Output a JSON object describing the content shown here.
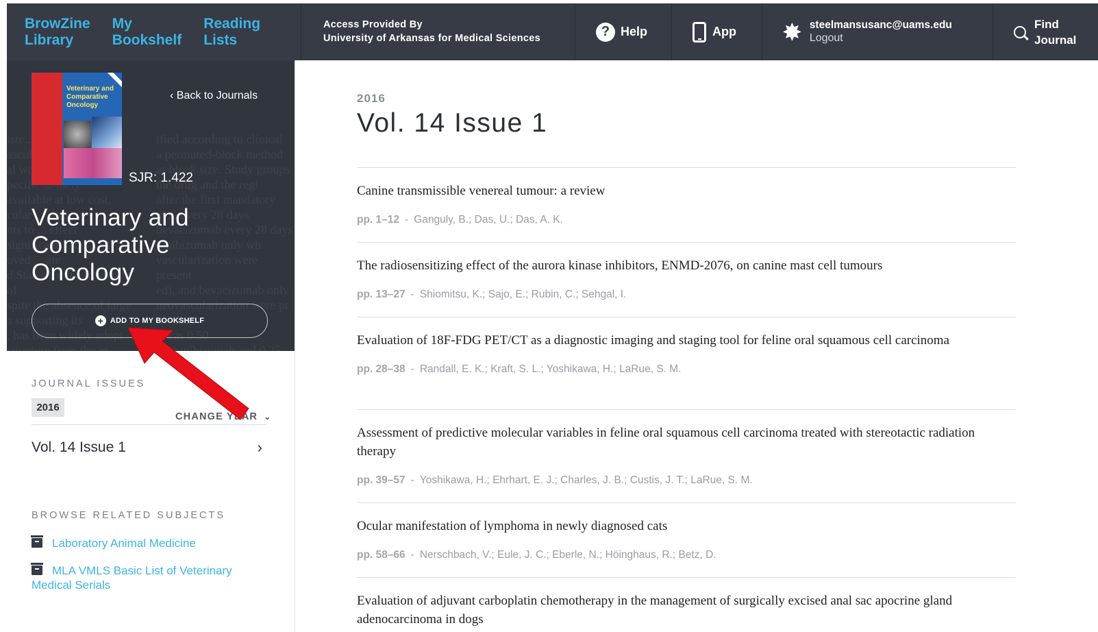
{
  "topbar": {
    "nav_links": [
      {
        "label": "BrowZine\nLibrary"
      },
      {
        "label": "My\nBookshelf"
      },
      {
        "label": "Reading\nLists"
      }
    ],
    "access_line1": "Access Provided By",
    "access_line2": "University of Arkansas for Medical Sciences",
    "help_label": "Help",
    "app_label": "App",
    "user_email": "steelmansusanc@uams.edu",
    "logout_label": "Logout",
    "find_journal_label": "Find\nJournal"
  },
  "sidebar": {
    "back_label": "Back to Journals",
    "sjr": "SJR: 1.422",
    "journal_title": "Veterinary and Comparative Oncology",
    "cover_title": "Veterinary and Comparative Oncology",
    "add_button_label": "ADD TO MY BOOKSHELF",
    "journal_issues_heading": "JOURNAL ISSUES",
    "selected_year": "2016",
    "change_year_label": "CHANGE YEAR",
    "issue_label": "Vol. 14 Issue 1",
    "related_heading": "BROWSE RELATED SUBJECTS",
    "subjects": [
      {
        "label": "Laboratory Animal Medicine"
      },
      {
        "label": "MLA VMLS Basic List of Veterinary Medical Serials"
      }
    ]
  },
  "main": {
    "year": "2016",
    "issue_title": "Vol. 14 Issue 1",
    "articles": [
      {
        "title": "Canine transmissible venereal tumour: a review",
        "pages": "pp. 1–12",
        "authors": "Ganguly, B.; Das, U.; Das, A. K."
      },
      {
        "title": "The radiosensitizing effect of the aurora kinase inhibitors, ENMD-2076, on canine mast cell tumours",
        "pages": "pp. 13–27",
        "authors": "Shiomitsu, K.; Sajo, E.; Rubin, C.; Sehgal, I."
      },
      {
        "title": "Evaluation of 18F-FDG PET/CT as a diagnostic imaging and staging tool for feline oral squamous cell carcinoma",
        "pages": "pp. 28–38",
        "authors": "Randall, E. K.; Kraft, S. L.; Yoshikawa, H.; LaRue, S. M."
      },
      {
        "title": "Assessment of predictive molecular variables in feline oral squamous cell carcinoma treated with stereotactic radiation therapy",
        "pages": "pp. 39–57",
        "authors": "Yoshikawa, H.; Ehrhart, E. J.; Charles, J. B.; Custis, J. T.; LaRue, S. M."
      },
      {
        "title": "Ocular manifestation of lymphoma in newly diagnosed cats",
        "pages": "pp. 58–66",
        "authors": "Nerschbach, V.; Eule, J. C.; Eberle, N.; Höinghaus, R.; Betz, D."
      },
      {
        "title": "Evaluation of adjuvant carboplatin chemotherapy in the management of surgically excised anal sac apocrine gland adenocarcinoma in dogs",
        "pages": "",
        "authors": ""
      }
    ]
  },
  "colors": {
    "nav_bg": "#363b45",
    "accent": "#3cb4e5",
    "sidebar_bg": "#31353d",
    "annotation_arrow": "#e8101a"
  },
  "icons": [
    "help-icon",
    "phone-icon",
    "gear-icon",
    "search-icon",
    "plus-circle-icon",
    "chevron-left-icon",
    "chevron-right-icon",
    "chevron-down-icon",
    "archive-box-icon"
  ]
}
